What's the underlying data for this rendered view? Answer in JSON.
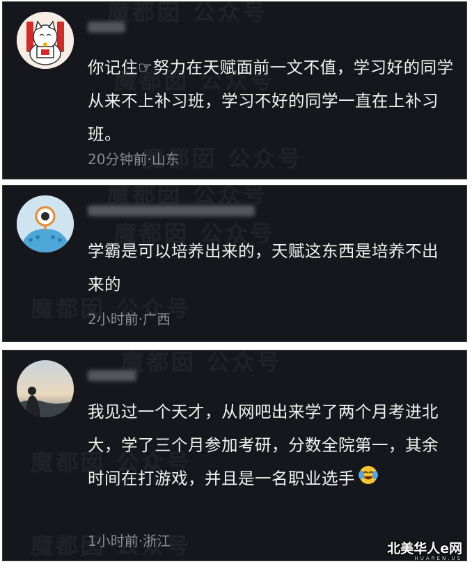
{
  "watermark": "魔都囡 公众号",
  "site_logo": {
    "title": "北美华人e网",
    "subtitle": "HUAREN.US"
  },
  "comments": [
    {
      "text": "你记住☞努力在天赋面前一文不值，学习好的同学从来不上补习班，学习不好的同学一直在上补习班。",
      "meta": "20分钟前·山东",
      "avatar": "lucky-cat-avatar"
    },
    {
      "text": "学霸是可以培养出来的，天赋这东西是培养不出来的",
      "meta": "2小时前·广西",
      "avatar": "cartoon-creature-avatar"
    },
    {
      "text": "我见过一个天才，从网吧出来学了两个月考进北大，学了三个月参加考研，分数全院第一，其余时间在打游戏，并且是一名职业选手",
      "meta": "1小时前·浙江",
      "avatar": "landscape-person-avatar",
      "emoji": "laughing-tears-emoji"
    }
  ],
  "colors": {
    "card_bg": "#16171c",
    "text": "#f2f2f2",
    "meta": "#8b8c92",
    "page_bg": "#ffffff"
  }
}
